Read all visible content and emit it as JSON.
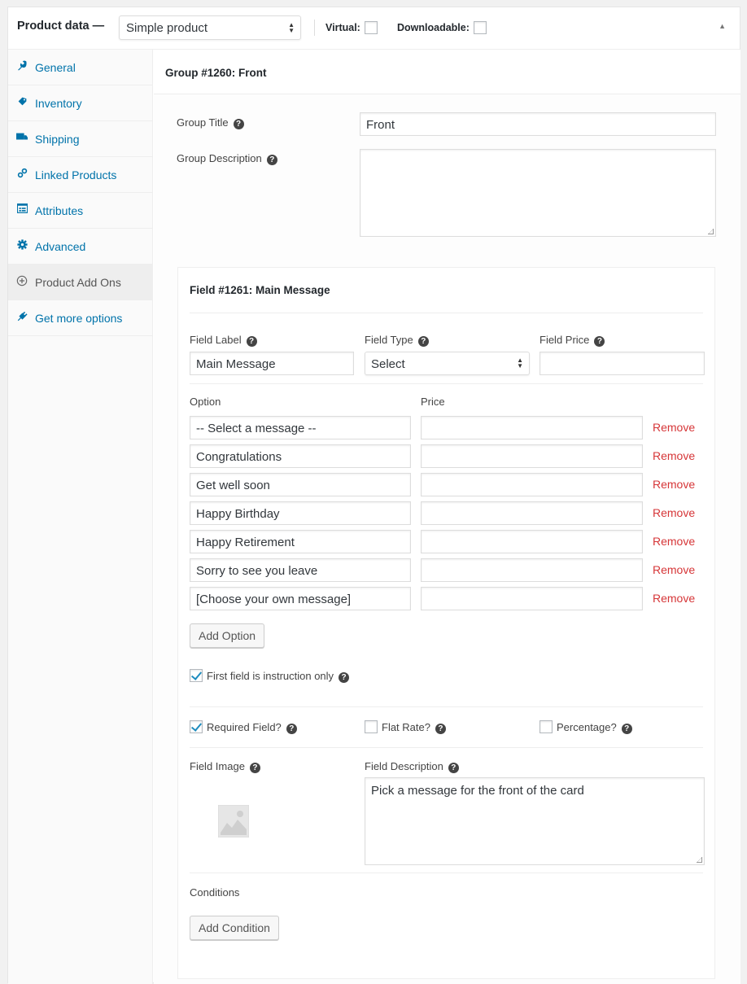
{
  "header": {
    "title": "Product data —",
    "product_type": "Simple product",
    "virtual_label": "Virtual:",
    "virtual_checked": false,
    "downloadable_label": "Downloadable:",
    "downloadable_checked": false,
    "collapse_icon": "▲"
  },
  "sidebar": {
    "items": [
      {
        "label": "General",
        "icon": "wrench-icon",
        "active": false
      },
      {
        "label": "Inventory",
        "icon": "tag-icon",
        "active": false
      },
      {
        "label": "Shipping",
        "icon": "truck-icon",
        "active": false
      },
      {
        "label": "Linked Products",
        "icon": "link-icon",
        "active": false
      },
      {
        "label": "Attributes",
        "icon": "list-icon",
        "active": false
      },
      {
        "label": "Advanced",
        "icon": "gear-icon",
        "active": false
      },
      {
        "label": "Product Add Ons",
        "icon": "plus-circle-icon",
        "active": true
      },
      {
        "label": "Get more options",
        "icon": "plugin-icon",
        "active": false
      }
    ]
  },
  "group": {
    "heading": "Group #1260: Front",
    "title_label": "Group Title",
    "title_value": "Front",
    "description_label": "Group Description",
    "description_value": ""
  },
  "field": {
    "heading": "Field #1261: Main Message",
    "label_label": "Field Label",
    "label_value": "Main Message",
    "type_label": "Field Type",
    "type_value": "Select",
    "price_label": "Field Price",
    "price_value": "",
    "option_header": "Option",
    "price_header": "Price",
    "remove_label": "Remove",
    "options": [
      {
        "option": "-- Select a message --",
        "price": ""
      },
      {
        "option": "Congratulations",
        "price": ""
      },
      {
        "option": "Get well soon",
        "price": ""
      },
      {
        "option": "Happy Birthday",
        "price": ""
      },
      {
        "option": "Happy Retirement",
        "price": ""
      },
      {
        "option": "Sorry to see you leave",
        "price": ""
      },
      {
        "option": "[Choose your own message]",
        "price": ""
      }
    ],
    "add_option_label": "Add Option",
    "first_instruction_label": "First field is instruction only",
    "first_instruction_checked": true,
    "required_label": "Required Field?",
    "required_checked": true,
    "flat_rate_label": "Flat Rate?",
    "flat_rate_checked": false,
    "percentage_label": "Percentage?",
    "percentage_checked": false,
    "image_label": "Field Image",
    "description_label": "Field Description",
    "description_value": "Pick a message for the front of the card",
    "conditions_label": "Conditions",
    "add_condition_label": "Add Condition"
  },
  "colors": {
    "link": "#0073aa",
    "remove": "#d63638",
    "check": "#1e8cbe"
  }
}
